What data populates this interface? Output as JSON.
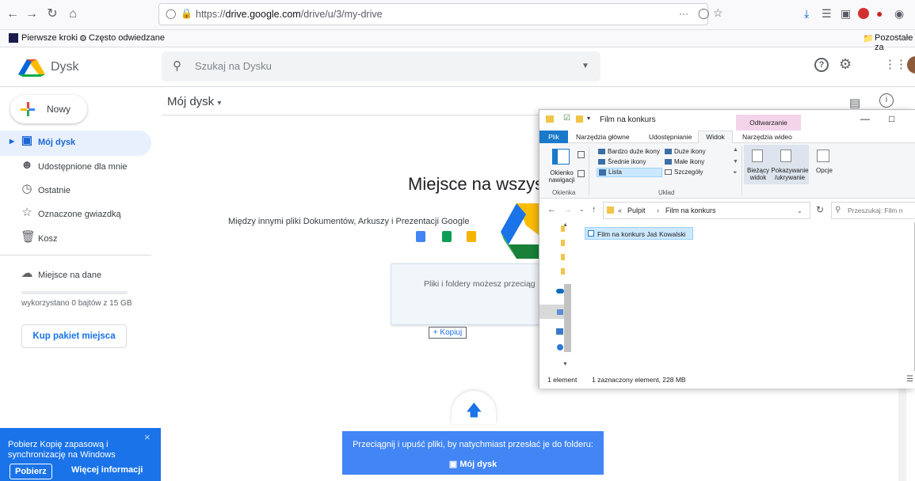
{
  "browser": {
    "url_prefix": "https://",
    "url_domain": "drive.google.com",
    "url_path": "/drive/u/3/my-drive",
    "url_more": "···"
  },
  "bookmarks": {
    "first": "Pierwsze kroki",
    "frequent": "Często odwiedzane",
    "other": "Pozostałe za"
  },
  "drive": {
    "logo_text": "Dysk",
    "search_placeholder": "Szukaj na Dysku",
    "new_label": "Nowy",
    "sidebar": [
      {
        "label": "Mój dysk"
      },
      {
        "label": "Udostępnione dla mnie"
      },
      {
        "label": "Ostatnie"
      },
      {
        "label": "Oznaczone gwiazdką"
      },
      {
        "label": "Kosz"
      }
    ],
    "storage_label": "Miejsce na dane",
    "storage_used": "wykorzystano 0 bajtów z 15 GB",
    "buy_storage": "Kup pakiet miejsca",
    "main_title": "Mój dysk",
    "empty_heading": "Miejsce na wszys",
    "empty_sub": "Między innymi pliki Dokumentów, Arkuszy i Prezentacji Google",
    "drag_hint": "Pliki i foldery możesz przeciąg",
    "copy_badge": "+ Kopiuj",
    "upload_hint": "Przeciągnij i upuść pliki, by natychmiast przesłać je do folderu:",
    "upload_target": "Mój dysk",
    "promo_title": "Pobierz Kopię zapasową i synchronizację na Windows",
    "promo_download": "Pobierz",
    "promo_more": "Więcej informacji",
    "promo_close": "×"
  },
  "explorer": {
    "title": "Film  na konkurs",
    "context_tab": "Odtwarzanie",
    "tabs": [
      "Plik",
      "Narzędzia główne",
      "Udostępnianie",
      "Widok",
      "Narzędzia wideo"
    ],
    "ribbon": {
      "nav_pane": "Okienko nawigacji",
      "pane_group": "Okienka",
      "extra_large": "Bardzo duże ikony",
      "large": "Duże ikony",
      "medium": "Średnie ikony",
      "small": "Małe ikony",
      "list": "Lista",
      "details": "Szczegóły",
      "layout_group": "Układ",
      "current_view": "Bieżący widok",
      "show_hide": "Pokazywanie /ukrywanie",
      "options": "Opcje"
    },
    "breadcrumb": [
      "Pulpit",
      "Film  na konkurs"
    ],
    "breadcrumb_more": "«",
    "search_placeholder": "Przeszukaj: Film n",
    "file_name": "Film na konkurs Jaś Kowalski",
    "status_count": "1 element",
    "status_selected": "1 zaznaczony element, 228 MB"
  }
}
